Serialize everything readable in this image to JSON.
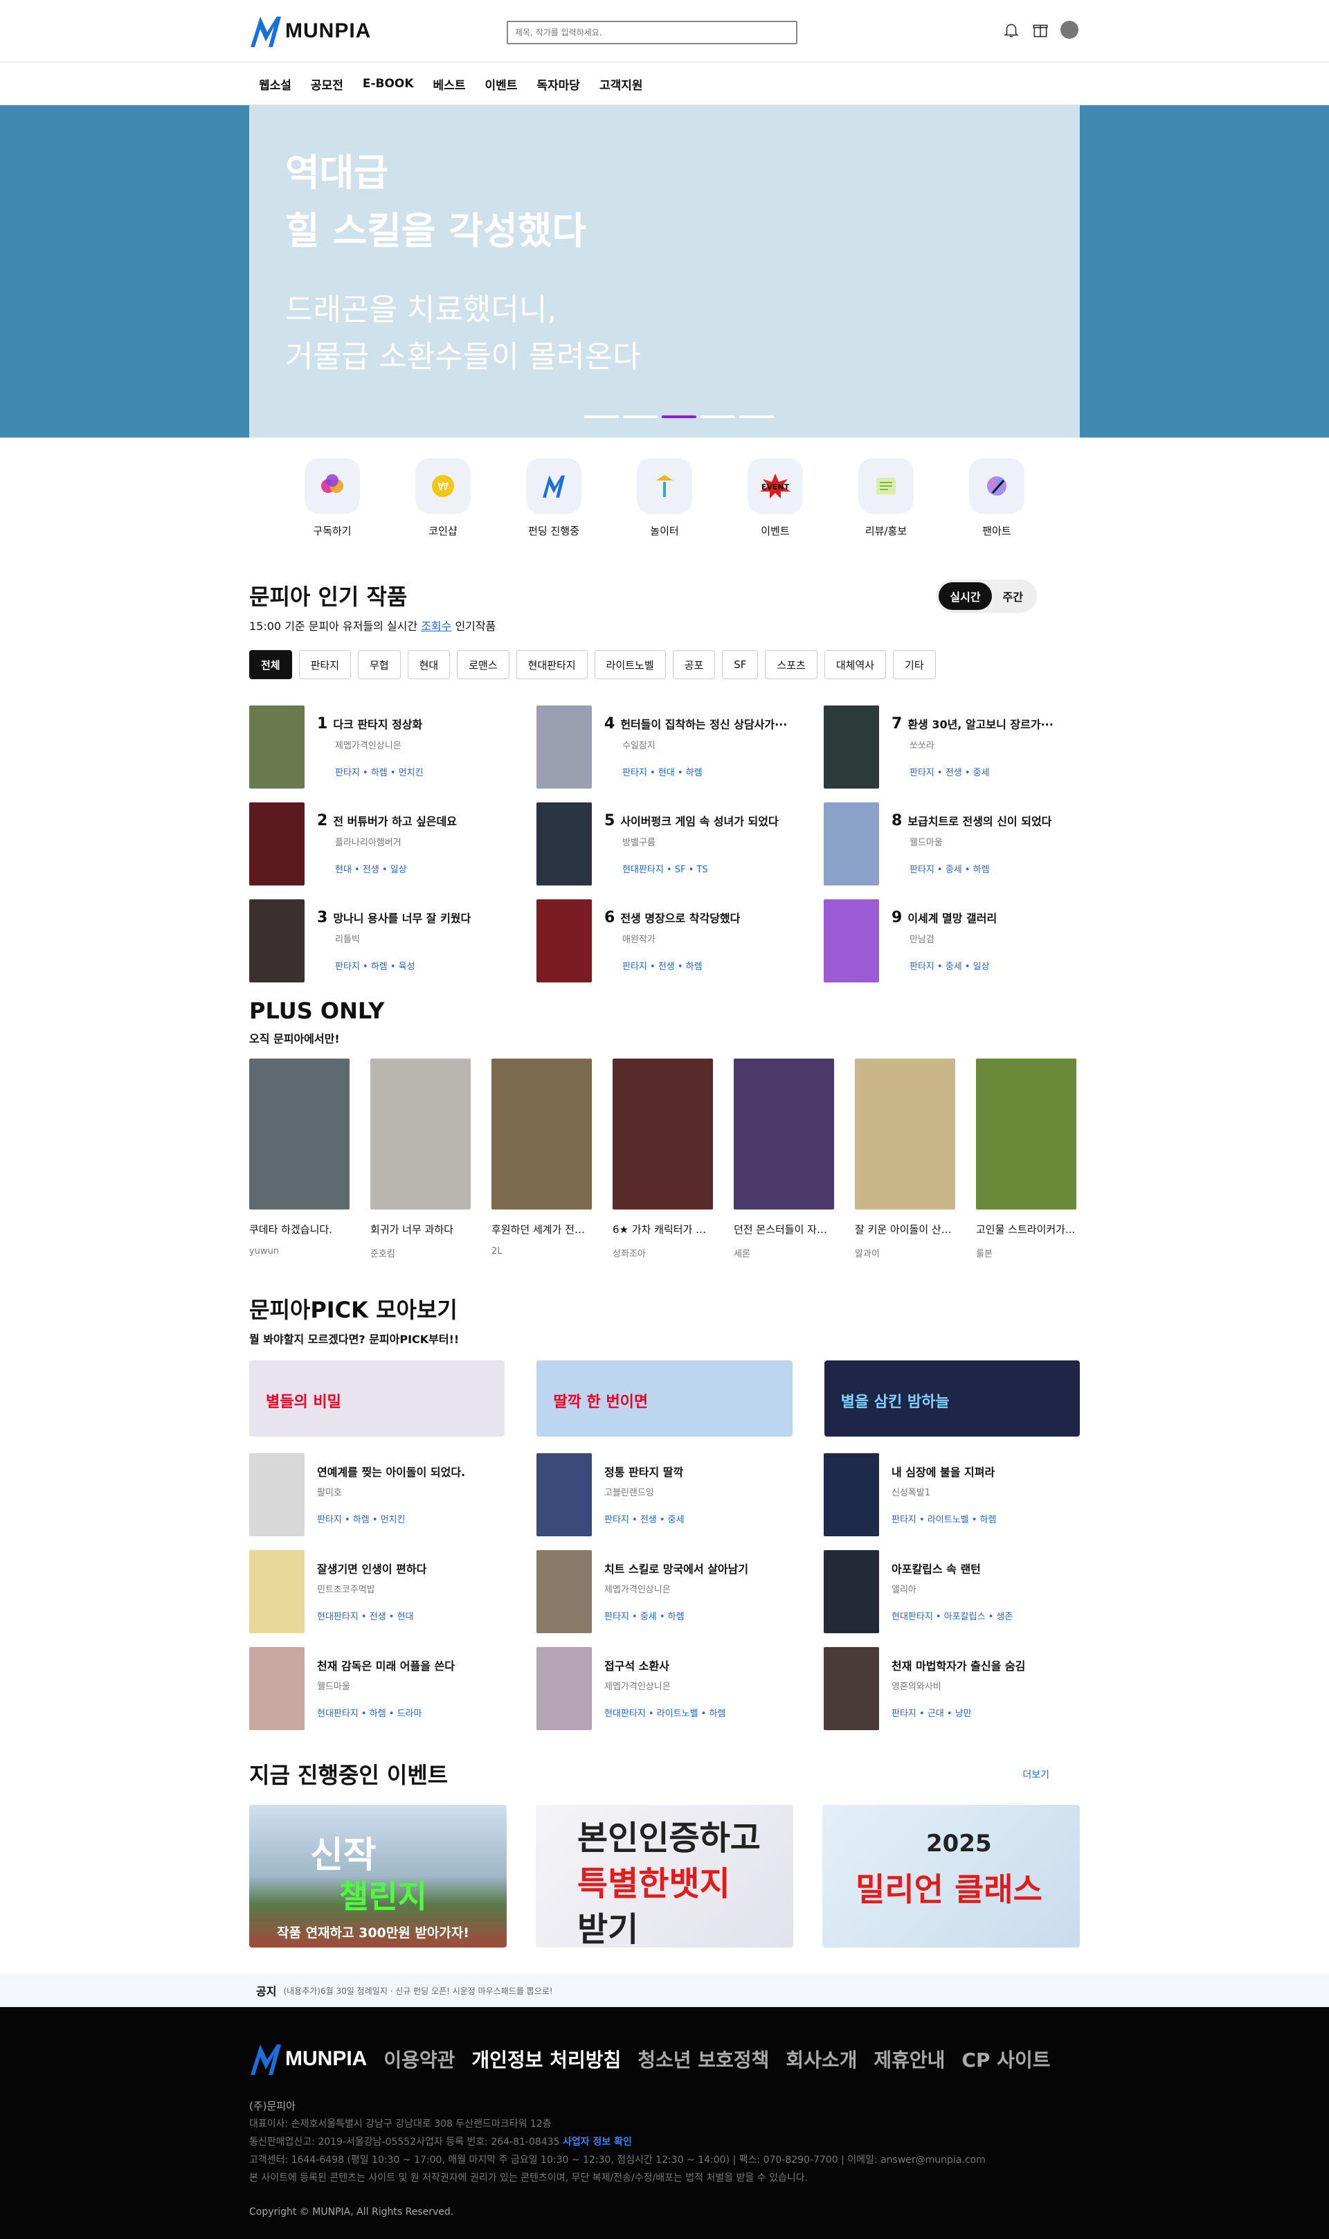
{
  "header": {
    "logo": "MUNPIA",
    "search_placeholder": "제목, 작가를 입력하세요."
  },
  "nav": [
    "웹소설",
    "공모전",
    "E-BOOK",
    "베스트",
    "이벤트",
    "독자마당",
    "고객지원"
  ],
  "hero": {
    "line1": "역대급",
    "line2": "힐 스킬을 각성했다",
    "line3": "드래곤을 치료했더니,",
    "line4": "거물급 소환수들이 몰려온다",
    "active_dot": 2,
    "dots": 5
  },
  "quick": [
    {
      "label": "구독하기",
      "icon": "subscribe-icon"
    },
    {
      "label": "코인샵",
      "icon": "coin-icon"
    },
    {
      "label": "펀딩 진행중",
      "icon": "funding-icon"
    },
    {
      "label": "놀이터",
      "icon": "playground-icon"
    },
    {
      "label": "이벤트",
      "icon": "event-icon"
    },
    {
      "label": "리뷰/홍보",
      "icon": "review-icon"
    },
    {
      "label": "팬아트",
      "icon": "fanart-icon"
    }
  ],
  "popular": {
    "title": "문피아 인기 작품",
    "sub_prefix": "15:00 기준 문피아 유저들의 실시간",
    "sub_link": "조회수",
    "sub_suffix": "인기작품",
    "toggle": [
      "실시간",
      "주간"
    ],
    "chips": [
      "전체",
      "판타지",
      "무협",
      "현대",
      "로맨스",
      "현대판타지",
      "라이트노벨",
      "공포",
      "SF",
      "스포츠",
      "대체역사",
      "기타"
    ],
    "items": [
      {
        "rank": "1",
        "title": "다크 판타지 정상화",
        "author": "제멥가격인상니은",
        "tags": "판타지 • 하렘 • 먼치킨",
        "color": "#6b7a4e"
      },
      {
        "rank": "4",
        "title": "헌터들이 집착하는 정신 상담사가···",
        "author": "수일잠지",
        "tags": "판타지 • 현대 • 하렘",
        "color": "#9aa0b2"
      },
      {
        "rank": "7",
        "title": "환생 30년, 알고보니 장르가···",
        "author": "쏘쏘라",
        "tags": "판타지 • 전생 • 중세",
        "color": "#2d3a3a"
      },
      {
        "rank": "2",
        "title": "전 버튜버가 하고 싶은데요",
        "author": "플라나리아햄버거",
        "tags": "현대 • 전생 • 일상",
        "color": "#5a1a1e"
      },
      {
        "rank": "5",
        "title": "사이버펑크 게임 속 성녀가 되었다",
        "author": "방벨구름",
        "tags": "현대판타지 • SF • TS",
        "color": "#2b3442"
      },
      {
        "rank": "8",
        "title": "보급치트로 전생의 신이 되었다",
        "author": "웰드마울",
        "tags": "판타지 • 중세 • 하렘",
        "color": "#8aa2c8"
      },
      {
        "rank": "3",
        "title": "망나니 용사를 너무 잘 키웠다",
        "author": "리틀빅",
        "tags": "판타지 • 하렘 • 육성",
        "color": "#3b3030"
      },
      {
        "rank": "6",
        "title": "전생 명장으로 착각당했다",
        "author": "애완작가",
        "tags": "판타지 • 전생 • 하렘",
        "color": "#7a1c22"
      },
      {
        "rank": "9",
        "title": "이세계 멸망 갤러리",
        "author": "만남검",
        "tags": "판타지 • 중세 • 일상",
        "color": "#9b5bd4"
      }
    ]
  },
  "plus": {
    "title": "PLUS ONLY",
    "sub": "오직 문피아에서만!",
    "books": [
      {
        "title": "쿠데타 하겠습니다.",
        "author": "yuwun",
        "color": "#5e6a6e"
      },
      {
        "title": "회귀가 너무 과하다",
        "author": "준호킴",
        "color": "#b9b6b1"
      },
      {
        "title": "후원하던 세계가 전쟁...",
        "author": "2L",
        "color": "#7b6a4e"
      },
      {
        "title": "6★ 가차 캐릭터가 되었다",
        "author": "성좌조아",
        "color": "#5a2b2b"
      },
      {
        "title": "던전 몬스터들이 자꾸...",
        "author": "세론",
        "color": "#4a3a6a"
      },
      {
        "title": "잘 키운 아이돌이 산책...",
        "author": "알과이",
        "color": "#c9b78a"
      },
      {
        "title": "고인물 스트라이커가...",
        "author": "룰본",
        "color": "#6a8a3a"
      }
    ]
  },
  "pick": {
    "title": "문피아PICK 모아보기",
    "sub": "뭘 봐야할지 모르겠다면? 문피아PICK부터!!",
    "banners": [
      {
        "text": "별들의 비밀",
        "color": "#e8e4ee"
      },
      {
        "text": "딸깍 한 번이면",
        "color": "#bcd6f0"
      },
      {
        "text": "별을 삼킨 밤하늘",
        "color": "#1e2547"
      }
    ],
    "items": [
      {
        "title": "연예계를 찢는 아이돌이 되었다.",
        "author": "팔미호",
        "tags": "판타지 • 하렘 • 먼치킨",
        "color": "#d8d8d8"
      },
      {
        "title": "정통 판타지 딸깍",
        "author": "고블린랜드잉",
        "tags": "판타지 • 전생 • 중세",
        "color": "#3a4a7a"
      },
      {
        "title": "내 심장에 불을 지펴라",
        "author": "신성폭발1",
        "tags": "판타지 • 라이트노벨 • 하렘",
        "color": "#1e2a4a"
      },
      {
        "title": "잘생기면 인생이 편하다",
        "author": "민트초코주먹밥",
        "tags": "현대판타지 • 전생 • 현대",
        "color": "#e9d79a"
      },
      {
        "title": "치트 스킬로 망국에서 살아남기",
        "author": "제멥가격인상니은",
        "tags": "판타지 • 중세 • 하렘",
        "color": "#8a7a6a"
      },
      {
        "title": "아포칼립스 속 랜턴",
        "author": "앨리아",
        "tags": "현대판타지 • 아포칼립스 • 생존",
        "color": "#232a36"
      },
      {
        "title": "천재 감독은 미래 어플을 쓴다",
        "author": "웰드마울",
        "tags": "현대판타지 • 하렘 • 드라마",
        "color": "#c8a8a0"
      },
      {
        "title": "접구석 소환사",
        "author": "제멥가격인상니은",
        "tags": "현대판타지 • 라이트노벨 • 하렘",
        "color": "#b4a4b4"
      },
      {
        "title": "천재 마법학자가 출신을 숨김",
        "author": "영혼의와사비",
        "tags": "판타지 • 근대 • 냥만",
        "color": "#4a3a3a"
      }
    ]
  },
  "events": {
    "title": "지금 진행중인 이벤트",
    "more": "더보기",
    "cards": [
      {
        "l1": "신작",
        "l2": "챌린지",
        "l3": "작품 연재하고 300만원 받아가자!"
      },
      {
        "l1": "본인인증하고",
        "l2": "특별한뱃지",
        "l3": "받기"
      },
      {
        "l1": "2025",
        "l2": "밀리언 클래스"
      }
    ]
  },
  "notice": {
    "label": "공지",
    "text": "(내용추가)6월 30일 정례일지 · 신규 펀딩 오픈! 시운정 마우스패드를 뽑으로!"
  },
  "footer": {
    "logo": "MUNPIA",
    "links": [
      "이용약관",
      "개인정보 처리방침",
      "청소년 보호정책",
      "회사소개",
      "제휴안내",
      "CP 사이트"
    ],
    "company": "(주)문피아",
    "line1": "대표이사: 손제호서울특별시 강남구 강남대로 308 두산랜드마크타워 12층",
    "line2": "통신판매업신고: 2019-서울강남-05552사업자 등록 번호: 264-81-08435",
    "line2_link": "사업자 정보 확인",
    "line3": "고객센터: 1644-6498 (평일 10:30 ~ 17:00, 매월 마지막 주 금요일 10:30 ~ 12:30, 점심시간 12:30 ~ 14:00)  |  팩스: 070-8290-7700  |  이메일: answer@munpia.com",
    "line4": "본 사이트에 등록된 콘텐츠는 사이트 및 원 저작권자에 권리가 있는 콘텐츠이며, 무단 복제/전송/수정/배포는 법적 처벌을 받을 수 있습니다.",
    "copyright": "Copyright © MUNPIA, All Rights Reserved."
  }
}
